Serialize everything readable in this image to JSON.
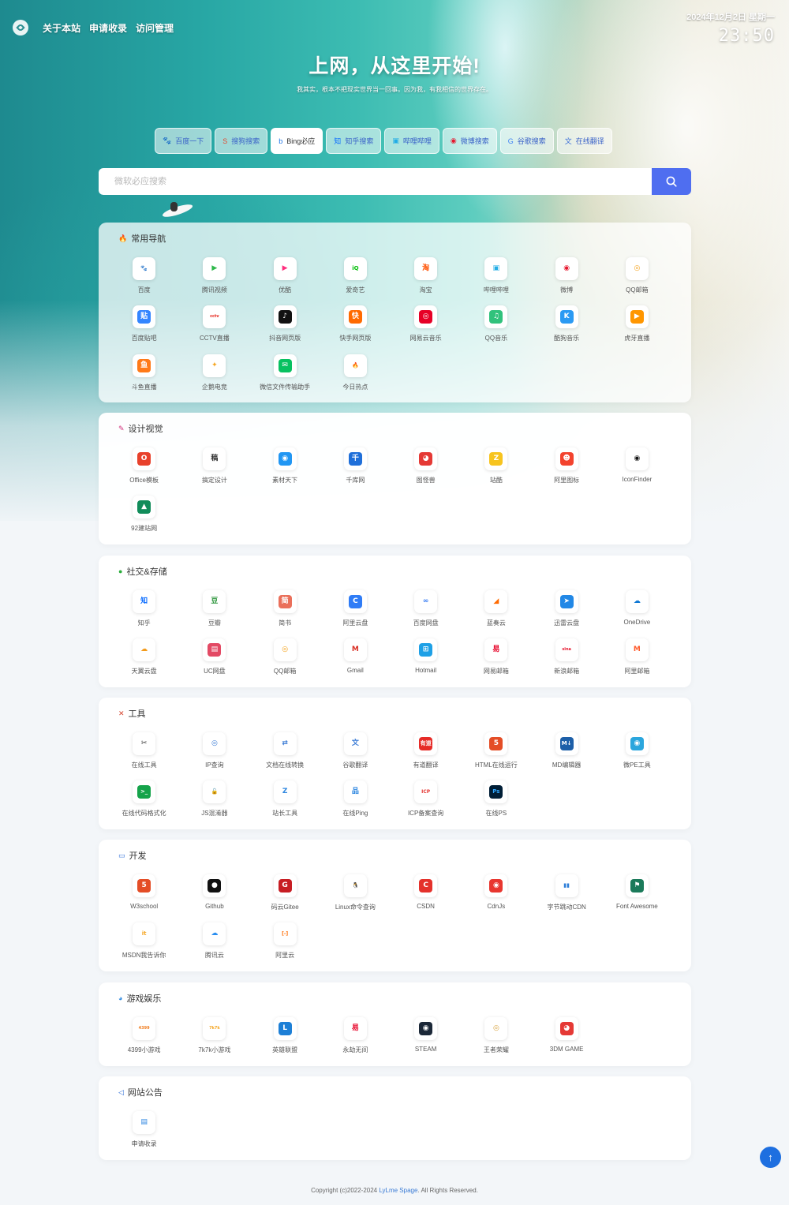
{
  "nav": {
    "links": [
      "关于本站",
      "申请收录",
      "访问管理"
    ]
  },
  "clock": {
    "date": "2024年12月2日 星期一",
    "time": "23:50"
  },
  "hero": {
    "title": "上网，从这里开始!",
    "subtitle": "我其实，根本不把现实世界当一回事。因为我，有我相信的世界存在。"
  },
  "engines": [
    {
      "label": "百度一下",
      "glyph": "🐾",
      "color": "#2e6be6"
    },
    {
      "label": "搜狗搜索",
      "glyph": "S",
      "color": "#e24b32"
    },
    {
      "label": "Bing必应",
      "glyph": "b",
      "color": "#1a73e8"
    },
    {
      "label": "知乎搜索",
      "glyph": "知",
      "color": "#0a6cff"
    },
    {
      "label": "哔哩哔哩",
      "glyph": "▣",
      "color": "#23ade5"
    },
    {
      "label": "微博搜索",
      "glyph": "◉",
      "color": "#e6162d"
    },
    {
      "label": "谷歌搜索",
      "glyph": "G",
      "color": "#4285f4"
    },
    {
      "label": "在线翻译",
      "glyph": "文",
      "color": "#3b6fd8"
    }
  ],
  "search": {
    "placeholder": "微软必应搜索"
  },
  "sections": [
    {
      "title": "常用导航",
      "icon": "🔥",
      "icon_color": "#e8382b",
      "items": [
        {
          "label": "百度",
          "glyph": "🐾",
          "fg": "#2e6be6",
          "bg": "#ffffff"
        },
        {
          "label": "腾讯视频",
          "glyph": "▶",
          "fg": "#2eb84b",
          "bg": "#ffffff"
        },
        {
          "label": "优酷",
          "glyph": "▶",
          "fg": "#ff2f7e",
          "bg": "#ffffff"
        },
        {
          "label": "爱奇艺",
          "glyph": "iQ",
          "fg": "#00be06",
          "bg": "#ffffff"
        },
        {
          "label": "淘宝",
          "glyph": "淘",
          "fg": "#ff5000",
          "bg": "#ffffff"
        },
        {
          "label": "哔哩哔哩",
          "glyph": "▣",
          "fg": "#23ade5",
          "bg": "#ffffff"
        },
        {
          "label": "微博",
          "glyph": "◉",
          "fg": "#e6162d",
          "bg": "#ffffff"
        },
        {
          "label": "QQ邮箱",
          "glyph": "◎",
          "fg": "#f4a21b",
          "bg": "#ffffff"
        },
        {
          "label": "百度贴吧",
          "glyph": "贴",
          "fg": "#ffffff",
          "bg": "#3385ff"
        },
        {
          "label": "CCTV直播",
          "glyph": "cctv",
          "fg": "#e62117",
          "bg": "#ffffff"
        },
        {
          "label": "抖音网页版",
          "glyph": "♪",
          "fg": "#ffffff",
          "bg": "#111111"
        },
        {
          "label": "快手网页版",
          "glyph": "快",
          "fg": "#ffffff",
          "bg": "#ff6a00"
        },
        {
          "label": "网易云音乐",
          "glyph": "◎",
          "fg": "#ffffff",
          "bg": "#e60026"
        },
        {
          "label": "QQ音乐",
          "glyph": "♫",
          "fg": "#ffffff",
          "bg": "#31c27c"
        },
        {
          "label": "酷狗音乐",
          "glyph": "K",
          "fg": "#ffffff",
          "bg": "#2b9af3"
        },
        {
          "label": "虎牙直播",
          "glyph": "▶",
          "fg": "#ffffff",
          "bg": "#ff9600"
        },
        {
          "label": "斗鱼直播",
          "glyph": "鱼",
          "fg": "#ffffff",
          "bg": "#ff7a18"
        },
        {
          "label": "企鹅电竞",
          "glyph": "✦",
          "fg": "#f5a623",
          "bg": "#ffffff"
        },
        {
          "label": "微信文件传输助手",
          "glyph": "✉",
          "fg": "#ffffff",
          "bg": "#07c160"
        },
        {
          "label": "今日热点",
          "glyph": "🔥",
          "fg": "#e8382b",
          "bg": "#ffffff"
        }
      ]
    },
    {
      "title": "设计视觉",
      "icon": "✎",
      "icon_color": "#d12f7a",
      "items": [
        {
          "label": "Office模板",
          "glyph": "O",
          "fg": "#ffffff",
          "bg": "#e8412b"
        },
        {
          "label": "搞定设计",
          "glyph": "稿",
          "fg": "#333333",
          "bg": "#ffffff"
        },
        {
          "label": "素材天下",
          "glyph": "◉",
          "fg": "#ffffff",
          "bg": "#2196f3"
        },
        {
          "label": "千库网",
          "glyph": "千",
          "fg": "#ffffff",
          "bg": "#1f6fd9"
        },
        {
          "label": "图怪兽",
          "glyph": "◕",
          "fg": "#ffffff",
          "bg": "#e53935"
        },
        {
          "label": "站酷",
          "glyph": "Z",
          "fg": "#ffffff",
          "bg": "#f7c41f"
        },
        {
          "label": "阿里图标",
          "glyph": "☻",
          "fg": "#ffffff",
          "bg": "#f3432e"
        },
        {
          "label": "IconFinder",
          "glyph": "◉",
          "fg": "#111111",
          "bg": "#ffffff"
        },
        {
          "label": "92建站网",
          "glyph": "▲",
          "fg": "#ffffff",
          "bg": "#118c5a"
        }
      ]
    },
    {
      "title": "社交&存储",
      "icon": "●",
      "icon_color": "#2bae3c",
      "items": [
        {
          "label": "知乎",
          "glyph": "知",
          "fg": "#0a6cff",
          "bg": "#ffffff"
        },
        {
          "label": "豆瓣",
          "glyph": "豆",
          "fg": "#2e963d",
          "bg": "#ffffff"
        },
        {
          "label": "简书",
          "glyph": "简",
          "fg": "#ffffff",
          "bg": "#ea6f5a"
        },
        {
          "label": "阿里云盘",
          "glyph": "C",
          "fg": "#ffffff",
          "bg": "#2f7cf6"
        },
        {
          "label": "百度网盘",
          "glyph": "∞",
          "fg": "#3a7ef4",
          "bg": "#ffffff"
        },
        {
          "label": "蓝奏云",
          "glyph": "◢",
          "fg": "#ff6a00",
          "bg": "#ffffff"
        },
        {
          "label": "迅雷云盘",
          "glyph": "➤",
          "fg": "#ffffff",
          "bg": "#2288e6"
        },
        {
          "label": "OneDrive",
          "glyph": "☁",
          "fg": "#0f78d4",
          "bg": "#ffffff"
        },
        {
          "label": "天翼云盘",
          "glyph": "☁",
          "fg": "#f39b1c",
          "bg": "#ffffff"
        },
        {
          "label": "UC网盘",
          "glyph": "▤",
          "fg": "#ffffff",
          "bg": "#e34964"
        },
        {
          "label": "QQ邮箱",
          "glyph": "◎",
          "fg": "#f4a21b",
          "bg": "#ffffff"
        },
        {
          "label": "Gmail",
          "glyph": "M",
          "fg": "#d93025",
          "bg": "#ffffff"
        },
        {
          "label": "Hotmail",
          "glyph": "⊞",
          "fg": "#ffffff",
          "bg": "#1ea0e6"
        },
        {
          "label": "网易邮箱",
          "glyph": "易",
          "fg": "#e60026",
          "bg": "#ffffff"
        },
        {
          "label": "新浪邮箱",
          "glyph": "sina",
          "fg": "#e6162d",
          "bg": "#ffffff"
        },
        {
          "label": "阿里邮箱",
          "glyph": "M",
          "fg": "#ff5b2d",
          "bg": "#ffffff"
        }
      ]
    },
    {
      "title": "工具",
      "icon": "✕",
      "icon_color": "#d5432c",
      "items": [
        {
          "label": "在线工具",
          "glyph": "✂",
          "fg": "#333333",
          "bg": "#ffffff"
        },
        {
          "label": "IP查询",
          "glyph": "◎",
          "fg": "#3a7bd5",
          "bg": "#ffffff"
        },
        {
          "label": "文档在线转换",
          "glyph": "⇄",
          "fg": "#3a7bd5",
          "bg": "#ffffff"
        },
        {
          "label": "谷歌翻译",
          "glyph": "文",
          "fg": "#3a7bd5",
          "bg": "#ffffff"
        },
        {
          "label": "有道翻译",
          "glyph": "有道",
          "fg": "#ffffff",
          "bg": "#e62b27"
        },
        {
          "label": "HTML在线运行",
          "glyph": "5",
          "fg": "#ffffff",
          "bg": "#e44d26"
        },
        {
          "label": "MD编辑器",
          "glyph": "M↓",
          "fg": "#ffffff",
          "bg": "#1d5fa8"
        },
        {
          "label": "微PE工具",
          "glyph": "◉",
          "fg": "#ffffff",
          "bg": "#2ba6dd"
        },
        {
          "label": "在线代码格式化",
          "glyph": ">_",
          "fg": "#ffffff",
          "bg": "#15a34a"
        },
        {
          "label": "JS混淆器",
          "glyph": "🔓",
          "fg": "#f3941f",
          "bg": "#ffffff"
        },
        {
          "label": "站长工具",
          "glyph": "Z",
          "fg": "#2d86e0",
          "bg": "#ffffff"
        },
        {
          "label": "在线Ping",
          "glyph": "品",
          "fg": "#2d86e0",
          "bg": "#ffffff"
        },
        {
          "label": "ICP备案查询",
          "glyph": "ICP",
          "fg": "#e53935",
          "bg": "#ffffff"
        },
        {
          "label": "在线PS",
          "glyph": "Ps",
          "fg": "#31a8ff",
          "bg": "#001e36"
        }
      ]
    },
    {
      "title": "开发",
      "icon": "▭",
      "icon_color": "#2f6fd8",
      "items": [
        {
          "label": "W3school",
          "glyph": "5",
          "fg": "#ffffff",
          "bg": "#e44d26"
        },
        {
          "label": "Github",
          "glyph": "●",
          "fg": "#ffffff",
          "bg": "#111111"
        },
        {
          "label": "码云Gitee",
          "glyph": "G",
          "fg": "#ffffff",
          "bg": "#c71d23"
        },
        {
          "label": "Linux命令查询",
          "glyph": "🐧",
          "fg": "#111111",
          "bg": "#ffffff"
        },
        {
          "label": "CSDN",
          "glyph": "C",
          "fg": "#ffffff",
          "bg": "#e4312b"
        },
        {
          "label": "CdnJs",
          "glyph": "◉",
          "fg": "#ffffff",
          "bg": "#e8362f"
        },
        {
          "label": "字节跳动CDN",
          "glyph": "▮▮",
          "fg": "#2d7ed8",
          "bg": "#ffffff"
        },
        {
          "label": "Font Awesome",
          "glyph": "⚑",
          "fg": "#ffffff",
          "bg": "#1b7a5a"
        },
        {
          "label": "MSDN我告诉你",
          "glyph": "it",
          "fg": "#f5a623",
          "bg": "#ffffff"
        },
        {
          "label": "腾讯云",
          "glyph": "☁",
          "fg": "#2a8ef0",
          "bg": "#ffffff"
        },
        {
          "label": "阿里云",
          "glyph": "[-]",
          "fg": "#ff6a00",
          "bg": "#ffffff"
        }
      ]
    },
    {
      "title": "游戏娱乐",
      "icon": "◕",
      "icon_color": "#2f8ae0",
      "items": [
        {
          "label": "4399小游戏",
          "glyph": "4399",
          "fg": "#f07c1e",
          "bg": "#ffffff"
        },
        {
          "label": "7k7k小游戏",
          "glyph": "7k7k",
          "fg": "#f5a623",
          "bg": "#ffffff"
        },
        {
          "label": "英雄联盟",
          "glyph": "L",
          "fg": "#ffffff",
          "bg": "#1d7fd6"
        },
        {
          "label": "永劫无间",
          "glyph": "易",
          "fg": "#e60026",
          "bg": "#ffffff"
        },
        {
          "label": "STEAM",
          "glyph": "◉",
          "fg": "#ffffff",
          "bg": "#1b2838"
        },
        {
          "label": "王者荣耀",
          "glyph": "◎",
          "fg": "#d9a441",
          "bg": "#ffffff"
        },
        {
          "label": "3DM GAME",
          "glyph": "◕",
          "fg": "#ffffff",
          "bg": "#e53935"
        }
      ]
    },
    {
      "title": "网站公告",
      "icon": "◁",
      "icon_color": "#2f6fd8",
      "items": [
        {
          "label": "申请收录",
          "glyph": "▤",
          "fg": "#2d86e0",
          "bg": "#ffffff"
        }
      ]
    }
  ],
  "footer": {
    "prefix": "Copyright (c)2022-2024 ",
    "brand": "LyLme Spage",
    "suffix": ". All Rights Reserved."
  },
  "colors": {
    "accent": "#4f6ef0",
    "page_bg": "#f3f6f9",
    "to_top": "#1e6fe0"
  }
}
